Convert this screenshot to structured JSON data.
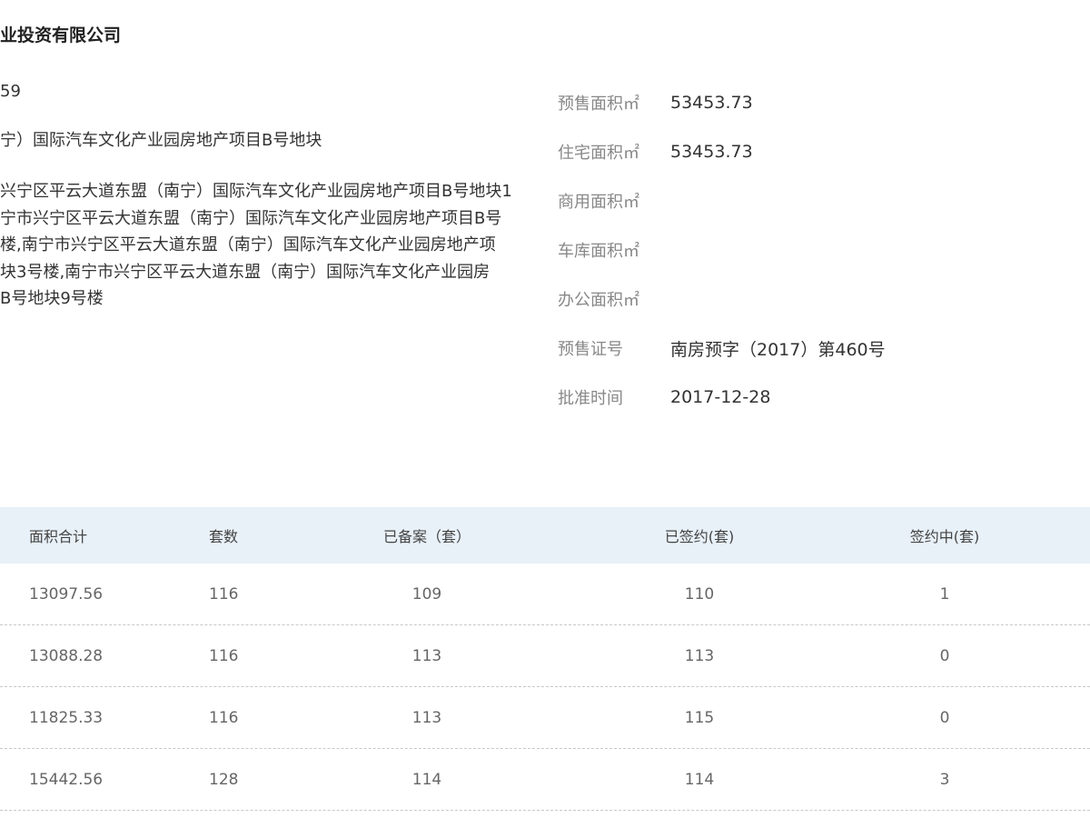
{
  "company": "业投资有限公司",
  "left": {
    "number": "59",
    "project": "宁）国际汽车文化产业园房地产项目B号地块",
    "address_lines": [
      "兴宁区平云大道东盟（南宁）国际汽车文化产业园房地产项目B号地块1",
      "宁市兴宁区平云大道东盟（南宁）国际汽车文化产业园房地产项目B号",
      "楼,南宁市兴宁区平云大道东盟（南宁）国际汽车文化产业园房地产项",
      "块3号楼,南宁市兴宁区平云大道东盟（南宁）国际汽车文化产业园房",
      "B号地块9号楼"
    ]
  },
  "right": {
    "items": [
      {
        "label": "预售面积㎡",
        "value": "53453.73"
      },
      {
        "label": "住宅面积㎡",
        "value": "53453.73"
      },
      {
        "label": "商用面积㎡",
        "value": ""
      },
      {
        "label": "车库面积㎡",
        "value": ""
      },
      {
        "label": "办公面积㎡",
        "value": ""
      },
      {
        "label": "预售证号",
        "value": "南房预字（2017）第460号"
      },
      {
        "label": "批准时间",
        "value": "2017-12-28"
      }
    ]
  },
  "table": {
    "headers": [
      "面积合计",
      "套数",
      "已备案（套）",
      "已签约(套)",
      "签约中(套)"
    ],
    "rows": [
      [
        "13097.56",
        "116",
        "109",
        "110",
        "1"
      ],
      [
        "13088.28",
        "116",
        "113",
        "113",
        "0"
      ],
      [
        "11825.33",
        "116",
        "113",
        "115",
        "0"
      ],
      [
        "15442.56",
        "128",
        "114",
        "114",
        "3"
      ]
    ]
  }
}
